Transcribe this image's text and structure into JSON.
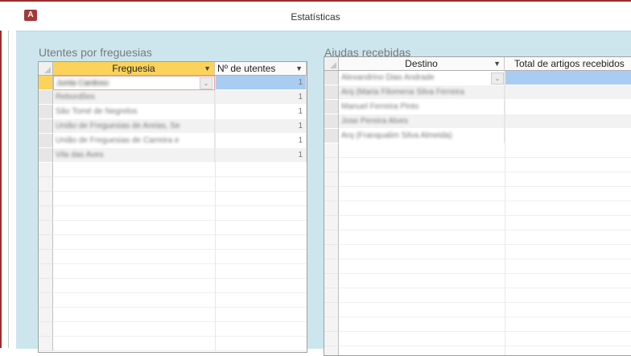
{
  "window": {
    "title": "Estatísticas",
    "app_icon": "access-icon",
    "accent": "#9c2b2b"
  },
  "utentes": {
    "title": "Utentes por freguesias",
    "columns": [
      "Freguesia",
      "Nº de utentes"
    ],
    "rows": [
      {
        "freguesia": "Junta Cardoso",
        "count": "1"
      },
      {
        "freguesia": "Rebordões",
        "count": "1"
      },
      {
        "freguesia": "São Tomé de Negrelos",
        "count": "1"
      },
      {
        "freguesia": "União de Freguesias de Areias, Se",
        "count": "1"
      },
      {
        "freguesia": "União de Freguesias de Carreira e",
        "count": "1"
      },
      {
        "freguesia": "Vila das Aves",
        "count": "1"
      }
    ]
  },
  "ajudas": {
    "title": "Ajudas recebidas",
    "columns": [
      "Destino",
      "Total de artigos recebidos"
    ],
    "rows": [
      {
        "destino": "Alexandrino Dias Andrade",
        "total": ""
      },
      {
        "destino": "Arq (Maria Filomena Silva Ferreira",
        "total": ""
      },
      {
        "destino": "Manuel Ferreira Pinto",
        "total": ""
      },
      {
        "destino": "Jose Pereira Alves",
        "total": ""
      },
      {
        "destino": "Arq (Franqualim Silva Almeida)",
        "total": ""
      }
    ]
  }
}
